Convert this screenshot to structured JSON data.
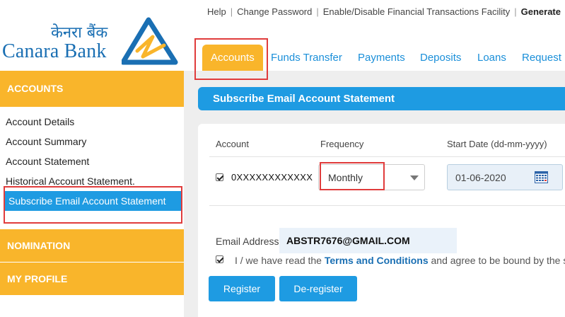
{
  "brand": {
    "name_hindi": "केनरा बैंक",
    "name_english": "Canara Bank",
    "logo_colors": {
      "blue": "#1a6fb3",
      "yellow": "#f9b52b"
    }
  },
  "top_links": [
    "Help",
    "Change Password",
    "Enable/Disable Financial Transactions Facility",
    "Generate"
  ],
  "nav_tabs": [
    "Accounts",
    "Funds Transfer",
    "Payments",
    "Deposits",
    "Loans",
    "Request"
  ],
  "sidebar": {
    "sections": [
      "ACCOUNTS",
      "NOMINATION",
      "MY PROFILE"
    ],
    "items": [
      "Account Details",
      "Account Summary",
      "Account Statement",
      "Historical Account Statement.",
      "Subscribe Email Account Statement"
    ]
  },
  "page": {
    "title": "Subscribe Email Account Statement",
    "columns": [
      "Account",
      "Frequency",
      "Start Date (dd-mm-yyyy)"
    ],
    "row": {
      "account": "0XXXXXXXXXXXX",
      "account_checked": true,
      "frequency": "Monthly",
      "start_date": "01-06-2020"
    },
    "email_label": "Email Address",
    "email_value": "ABSTR7676@GMAIL.COM",
    "terms": {
      "checked": true,
      "before": "I / we have read the ",
      "link": "Terms and Conditions",
      "after": " and agree to be bound by the s"
    },
    "buttons": {
      "register": "Register",
      "deregister": "De-register"
    }
  },
  "colors": {
    "accent_blue": "#1e9be2",
    "accent_yellow": "#f9b52b",
    "highlight_red": "#e03c3c"
  }
}
